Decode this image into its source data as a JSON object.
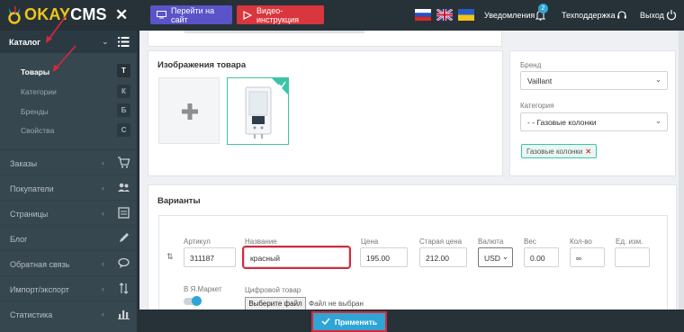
{
  "header": {
    "logo_text_prefix": "OKAY",
    "logo_text_suffix": "CMS",
    "close_label": "✕",
    "visit_site_label": "Перейти на сайт",
    "video_label": "Видео-инструкция",
    "notifications_label": "Уведомления",
    "notifications_count": "2",
    "support_label": "Техподдержка",
    "logout_label": "Выход"
  },
  "sidebar": {
    "section_label": "Каталог",
    "sub_items": [
      {
        "label": "Товары",
        "letter": "Т"
      },
      {
        "label": "Категории",
        "letter": "К"
      },
      {
        "label": "Бренды",
        "letter": "Б"
      },
      {
        "label": "Свойства",
        "letter": "С"
      }
    ],
    "items": [
      {
        "label": "Заказы"
      },
      {
        "label": "Покупатели"
      },
      {
        "label": "Страницы"
      },
      {
        "label": "Блог"
      },
      {
        "label": "Обратная связь"
      },
      {
        "label": "Импорт/экспорт"
      },
      {
        "label": "Статистика"
      }
    ]
  },
  "images": {
    "title": "Изображения товара"
  },
  "right_panel": {
    "brand_label": "Бренд",
    "brand_value": "Vaillant",
    "category_label": "Категория",
    "category_value": "- - Газовые колонки",
    "category_tag": "Газовые колонки"
  },
  "variants": {
    "title": "Варианты",
    "labels": {
      "sku": "Артикул",
      "name": "Название",
      "price": "Цена",
      "old_price": "Старая цена",
      "currency": "Валюта",
      "weight": "Вес",
      "stock": "Кол-во",
      "unit": "Ед. изм.",
      "yandex": "В Я.Маркет",
      "digital": "Цифровой товар"
    },
    "row": {
      "sku": "311187",
      "name": "красный",
      "price": "195.00",
      "old_price": "212.00",
      "currency": "USD",
      "weight": "0.00",
      "stock": "∞",
      "unit": ""
    },
    "file_button": "Выберите файл",
    "file_none": "Файл не выбран"
  },
  "footer": {
    "apply_label": "Применить"
  },
  "colors": {
    "header_bg": "#263238",
    "sidebar_bg": "#37474f",
    "accent_blue": "#2fa5d6",
    "accent_teal": "#3cc4a5",
    "highlight_red": "#d9283a"
  }
}
